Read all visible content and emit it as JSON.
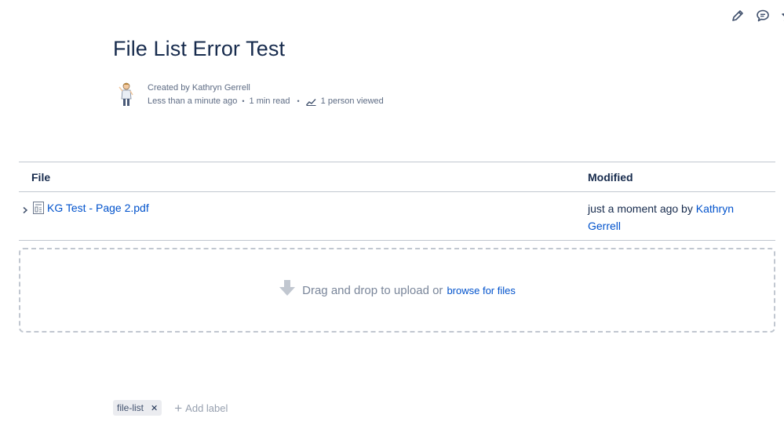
{
  "page": {
    "title": "File List Error Test"
  },
  "byline": {
    "created_by": "Created by Kathryn Gerrell",
    "time": "Less than a minute ago",
    "read_time": "1 min read",
    "views": "1 person viewed"
  },
  "file_table": {
    "headers": {
      "file": "File",
      "modified": "Modified"
    },
    "rows": [
      {
        "name": "KG Test - Page 2.pdf",
        "modified_prefix": "just a moment ago by ",
        "modified_by": "Kathryn Gerrell"
      }
    ]
  },
  "dropzone": {
    "text": "Drag and drop to upload or",
    "browse": "browse for files"
  },
  "labels": {
    "items": [
      "file-list"
    ],
    "add": "Add label"
  },
  "icons": {
    "edit": "pencil-icon",
    "comment": "comment-icon",
    "star": "star-icon"
  },
  "colors": {
    "link": "#0052cc",
    "text": "#172b4d",
    "muted": "#5e6c84"
  }
}
